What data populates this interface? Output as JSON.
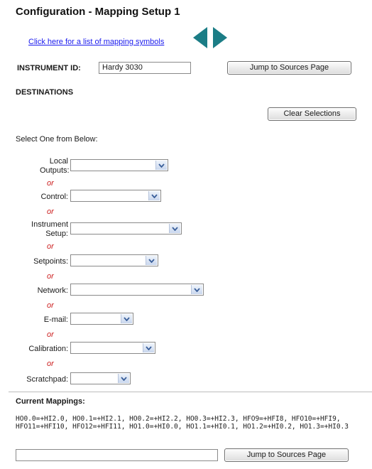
{
  "page": {
    "title": "Configuration - Mapping Setup 1",
    "symbols_link": "Click here for a list of mapping symbols"
  },
  "instrument": {
    "label": "INSTRUMENT ID:",
    "value": "Hardy 3030",
    "jump_button": "Jump to Sources Page"
  },
  "destinations": {
    "heading": "DESTINATIONS",
    "clear_button": "Clear Selections",
    "prompt": "Select One from Below:",
    "or_text": "or",
    "rows": [
      {
        "label": "Local Outputs:",
        "value": ""
      },
      {
        "label": "Control:",
        "value": ""
      },
      {
        "label": "Instrument Setup:",
        "value": ""
      },
      {
        "label": "Setpoints:",
        "value": ""
      },
      {
        "label": "Network:",
        "value": ""
      },
      {
        "label": "E-mail:",
        "value": ""
      },
      {
        "label": "Calibration:",
        "value": ""
      },
      {
        "label": "Scratchpad:",
        "value": ""
      }
    ]
  },
  "mappings": {
    "heading": "Current Mappings:",
    "text": "HO0.0=+HI2.0, HO0.1=+HI2.1, HO0.2=+HI2.2, HO0.3=+HI2.3, HFO9=+HFI8, HFO10=+HFI9, HFO11=+HFI10, HFO12=+HFI11, HO1.0=+HI0.0, HO1.1=+HI0.1, HO1.2=+HI0.2, HO1.3=+HI0.3"
  },
  "footer": {
    "input_value": "",
    "jump_button": "Jump to Sources Page"
  },
  "colors": {
    "arrow": "#1b7d86",
    "or_text": "#cc2020",
    "link": "#1a1aee"
  },
  "icons": [
    "arrow-left-icon",
    "arrow-right-icon",
    "chevron-down-icon"
  ]
}
